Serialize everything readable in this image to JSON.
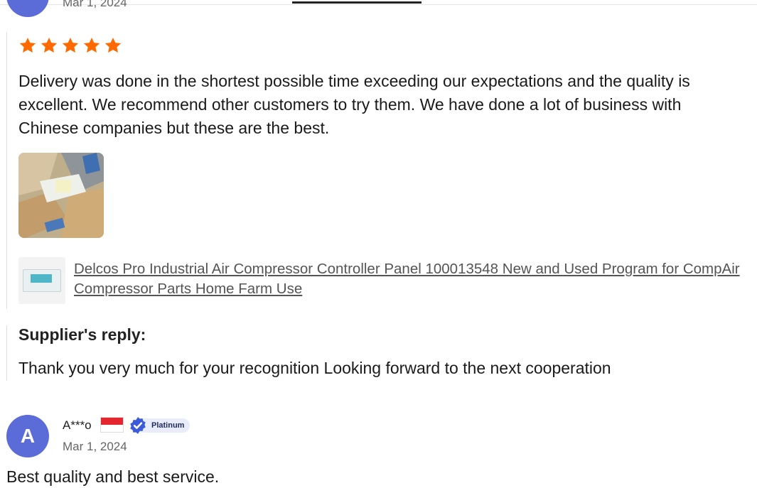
{
  "previous_review": {
    "date": "Mar 1, 2024",
    "rating": 5,
    "text": "Delivery was done in the shortest possible time exceeding our expectations and the quality is excellent. We recommend other customers to try them. We have done a lot of business with Chinese companies but these are the best.",
    "product_link": "Delcos Pro Industrial Air Compressor Controller Panel 100013548 New and Used Program for CompAir Compressor Parts Home Farm Use",
    "supplier_reply": {
      "title": "Supplier's reply:",
      "text": "Thank you very much for your recognition Looking forward to the next cooperation"
    }
  },
  "next_review": {
    "avatar_letter": "A",
    "reviewer_name": "A***o",
    "badge": "Platinum",
    "date": "Mar 1, 2024",
    "text": "Best quality and best service."
  },
  "colors": {
    "star": "#ff6a00",
    "avatar": "#5b6bd7",
    "badge_check": "#3b5bdb",
    "link": "#555555"
  },
  "icons": {
    "rating_star": "star-icon",
    "verified_badge": "verified-check-icon",
    "country_flag": "indonesia-flag-icon"
  }
}
